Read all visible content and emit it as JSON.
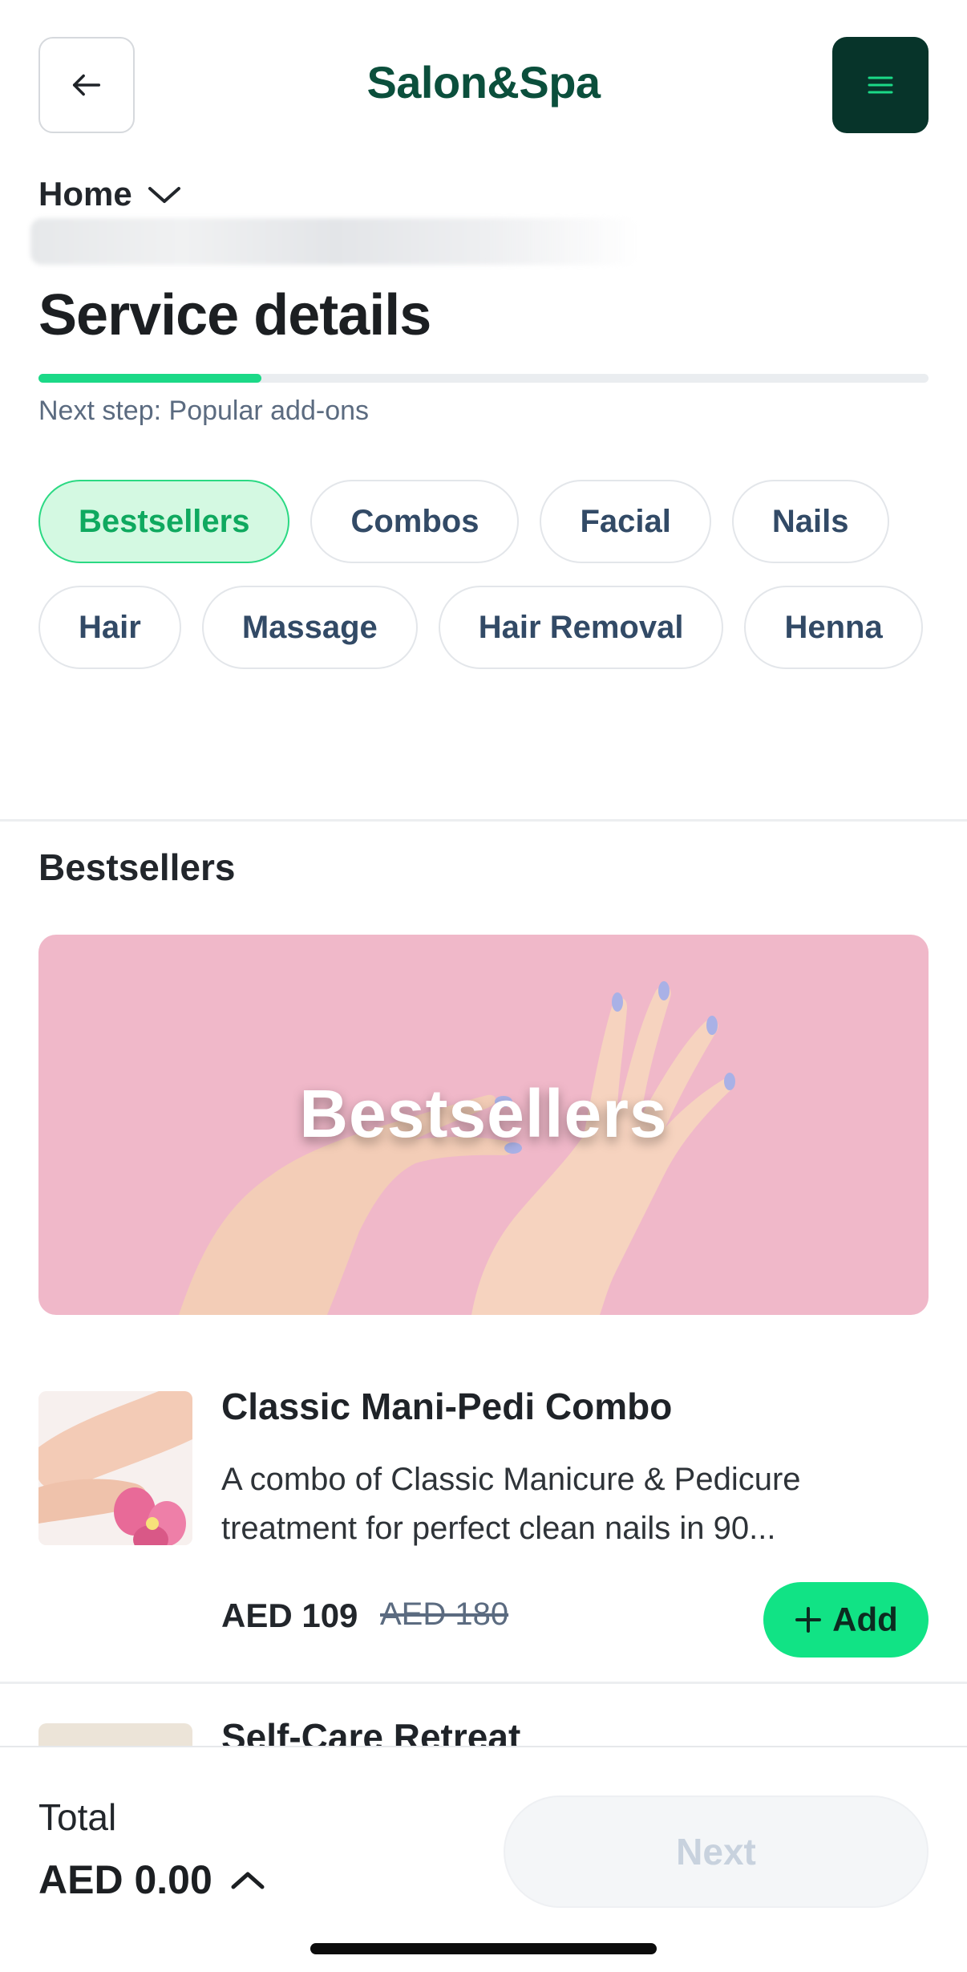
{
  "header": {
    "brand": "Salon&Spa",
    "back_icon": "arrow-left-icon",
    "menu_icon": "hamburger-menu-icon"
  },
  "breadcrumb": {
    "label": "Home"
  },
  "page": {
    "title": "Service details",
    "progress": 0.25,
    "next_step": "Next step: Popular add-ons"
  },
  "categories": [
    {
      "label": "Bestsellers",
      "active": true
    },
    {
      "label": "Combos",
      "active": false
    },
    {
      "label": "Facial",
      "active": false
    },
    {
      "label": "Nails",
      "active": false
    },
    {
      "label": "Hair",
      "active": false
    },
    {
      "label": "Massage",
      "active": false
    },
    {
      "label": "Hair Removal",
      "active": false
    },
    {
      "label": "Henna",
      "active": false
    }
  ],
  "section": {
    "title": "Bestsellers",
    "banner_text": "Bestsellers"
  },
  "services": [
    {
      "title": "Classic Mani-Pedi Combo",
      "description": "A combo of Classic Manicure & Pedicure treatment for perfect clean nails in 90...",
      "price": "AED 109",
      "old_price": "AED 180",
      "add_label": "Add"
    },
    {
      "title": "Self-Care Retreat"
    }
  ],
  "footer": {
    "total_label": "Total",
    "total_value": "AED 0.00",
    "next_label": "Next"
  },
  "colors": {
    "brand": "#0b4f3c",
    "accent": "#11e385",
    "menu_bg": "#07342a",
    "banner_bg": "#f0b8c9"
  }
}
